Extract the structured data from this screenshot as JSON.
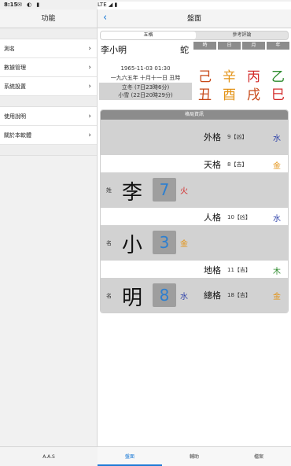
{
  "status": {
    "time": "8:15",
    "icons": "✉ ◐ ▮",
    "right": "LTE ◢ ▮"
  },
  "sidebar": {
    "title": "功能",
    "items": [
      {
        "label": "測名"
      },
      {
        "label": "數據管理"
      },
      {
        "label": "系統設置"
      },
      {
        "label": "使用說明"
      },
      {
        "label": "關於本軟體"
      }
    ],
    "footer": "A.A.S"
  },
  "nav": {
    "title": "盤面",
    "back": "‹"
  },
  "segments": [
    "五格",
    "參考評論"
  ],
  "person": {
    "name": "李小明",
    "zodiac": "蛇",
    "solar": "1965-11-03 01:30",
    "lunar": "一九六五年 十月十一日 丑時",
    "term1": "立冬 (7日23時6分)",
    "term2": "小雪 (22日20時29分)"
  },
  "pillars": {
    "headers": [
      "時",
      "日",
      "月",
      "年"
    ],
    "stems": [
      {
        "ch": "己",
        "color": "#c84a1a"
      },
      {
        "ch": "辛",
        "color": "#e39316"
      },
      {
        "ch": "丙",
        "color": "#d32b2b"
      },
      {
        "ch": "乙",
        "color": "#2e8b2e"
      }
    ],
    "branches": [
      {
        "ch": "丑",
        "color": "#c84a1a"
      },
      {
        "ch": "酉",
        "color": "#e39316"
      },
      {
        "ch": "戌",
        "color": "#c84a1a"
      },
      {
        "ch": "巳",
        "color": "#d32b2b"
      }
    ]
  },
  "panel": {
    "title": "格局資訊",
    "waige": {
      "label": "外格",
      "detail": "9【凶】",
      "elem": "水",
      "color": "#2b3fa8"
    },
    "tiange": {
      "label": "天格",
      "detail": "8【吉】",
      "elem": "金",
      "color": "#e39316"
    },
    "surname": {
      "tag": "姓",
      "ch": "李",
      "num": "7",
      "elem": "火",
      "color": "#d32b2b"
    },
    "renge": {
      "label": "人格",
      "detail": "10【凶】",
      "elem": "水",
      "color": "#2b3fa8"
    },
    "given1": {
      "tag": "名",
      "ch": "小",
      "num": "3",
      "elem": "金",
      "color": "#e39316"
    },
    "dige": {
      "label": "地格",
      "detail": "11【吉】",
      "elem": "木",
      "color": "#2e8b2e"
    },
    "given2": {
      "tag": "名",
      "ch": "明",
      "num": "8",
      "elem": "水",
      "color": "#2b3fa8"
    },
    "zongge": {
      "label": "總格",
      "detail": "18【吉】",
      "elem": "金",
      "color": "#e39316"
    }
  },
  "tabs": [
    "盤面",
    "輔助",
    "檔案"
  ]
}
